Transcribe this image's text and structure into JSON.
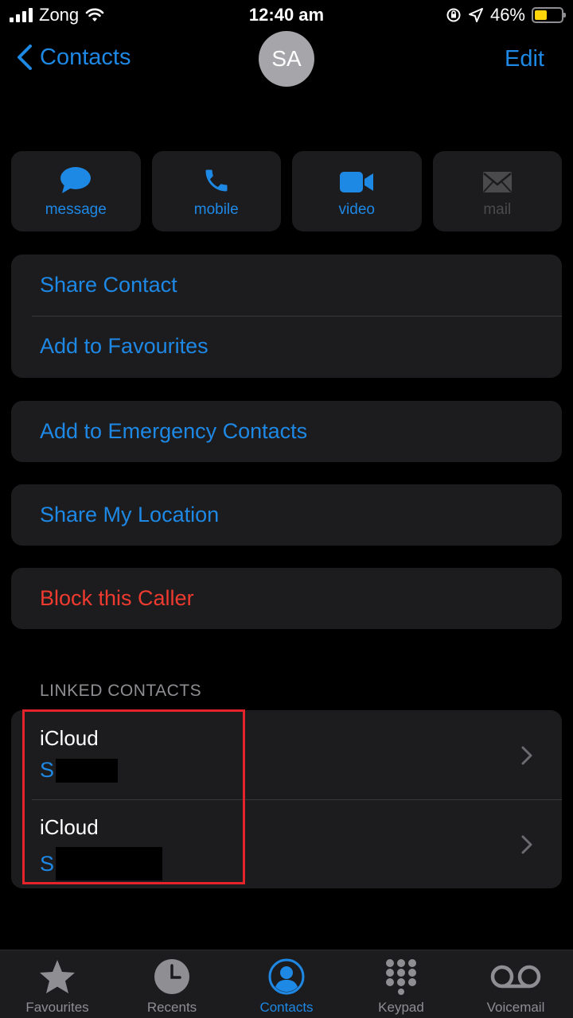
{
  "status_bar": {
    "carrier": "Zong",
    "time": "12:40 am",
    "battery_percent": "46%",
    "battery_level": 0.46
  },
  "nav": {
    "back_label": "Contacts",
    "avatar_initials": "SA",
    "edit_label": "Edit"
  },
  "actions": [
    {
      "label": "message",
      "icon": "message-icon",
      "enabled": true
    },
    {
      "label": "mobile",
      "icon": "phone-icon",
      "enabled": true
    },
    {
      "label": "video",
      "icon": "video-icon",
      "enabled": true
    },
    {
      "label": "mail",
      "icon": "mail-icon",
      "enabled": false
    }
  ],
  "options": {
    "share_contact": "Share Contact",
    "add_favourites": "Add to Favourites",
    "emergency": "Add to Emergency Contacts",
    "share_location": "Share My Location",
    "block": "Block this Caller"
  },
  "linked_contacts": {
    "header": "LINKED CONTACTS",
    "items": [
      {
        "source": "iCloud",
        "name_visible": "S"
      },
      {
        "source": "iCloud",
        "name_visible": "S"
      }
    ]
  },
  "tabs": [
    {
      "label": "Favourites",
      "icon": "star-icon",
      "active": false
    },
    {
      "label": "Recents",
      "icon": "clock-icon",
      "active": false
    },
    {
      "label": "Contacts",
      "icon": "person-circle-icon",
      "active": true
    },
    {
      "label": "Keypad",
      "icon": "keypad-icon",
      "active": false
    },
    {
      "label": "Voicemail",
      "icon": "voicemail-icon",
      "active": false
    }
  ],
  "colors": {
    "accent": "#1e88e5",
    "danger": "#ef3b2f",
    "highlight": "#e5232a",
    "cell": "#1c1c1e"
  }
}
